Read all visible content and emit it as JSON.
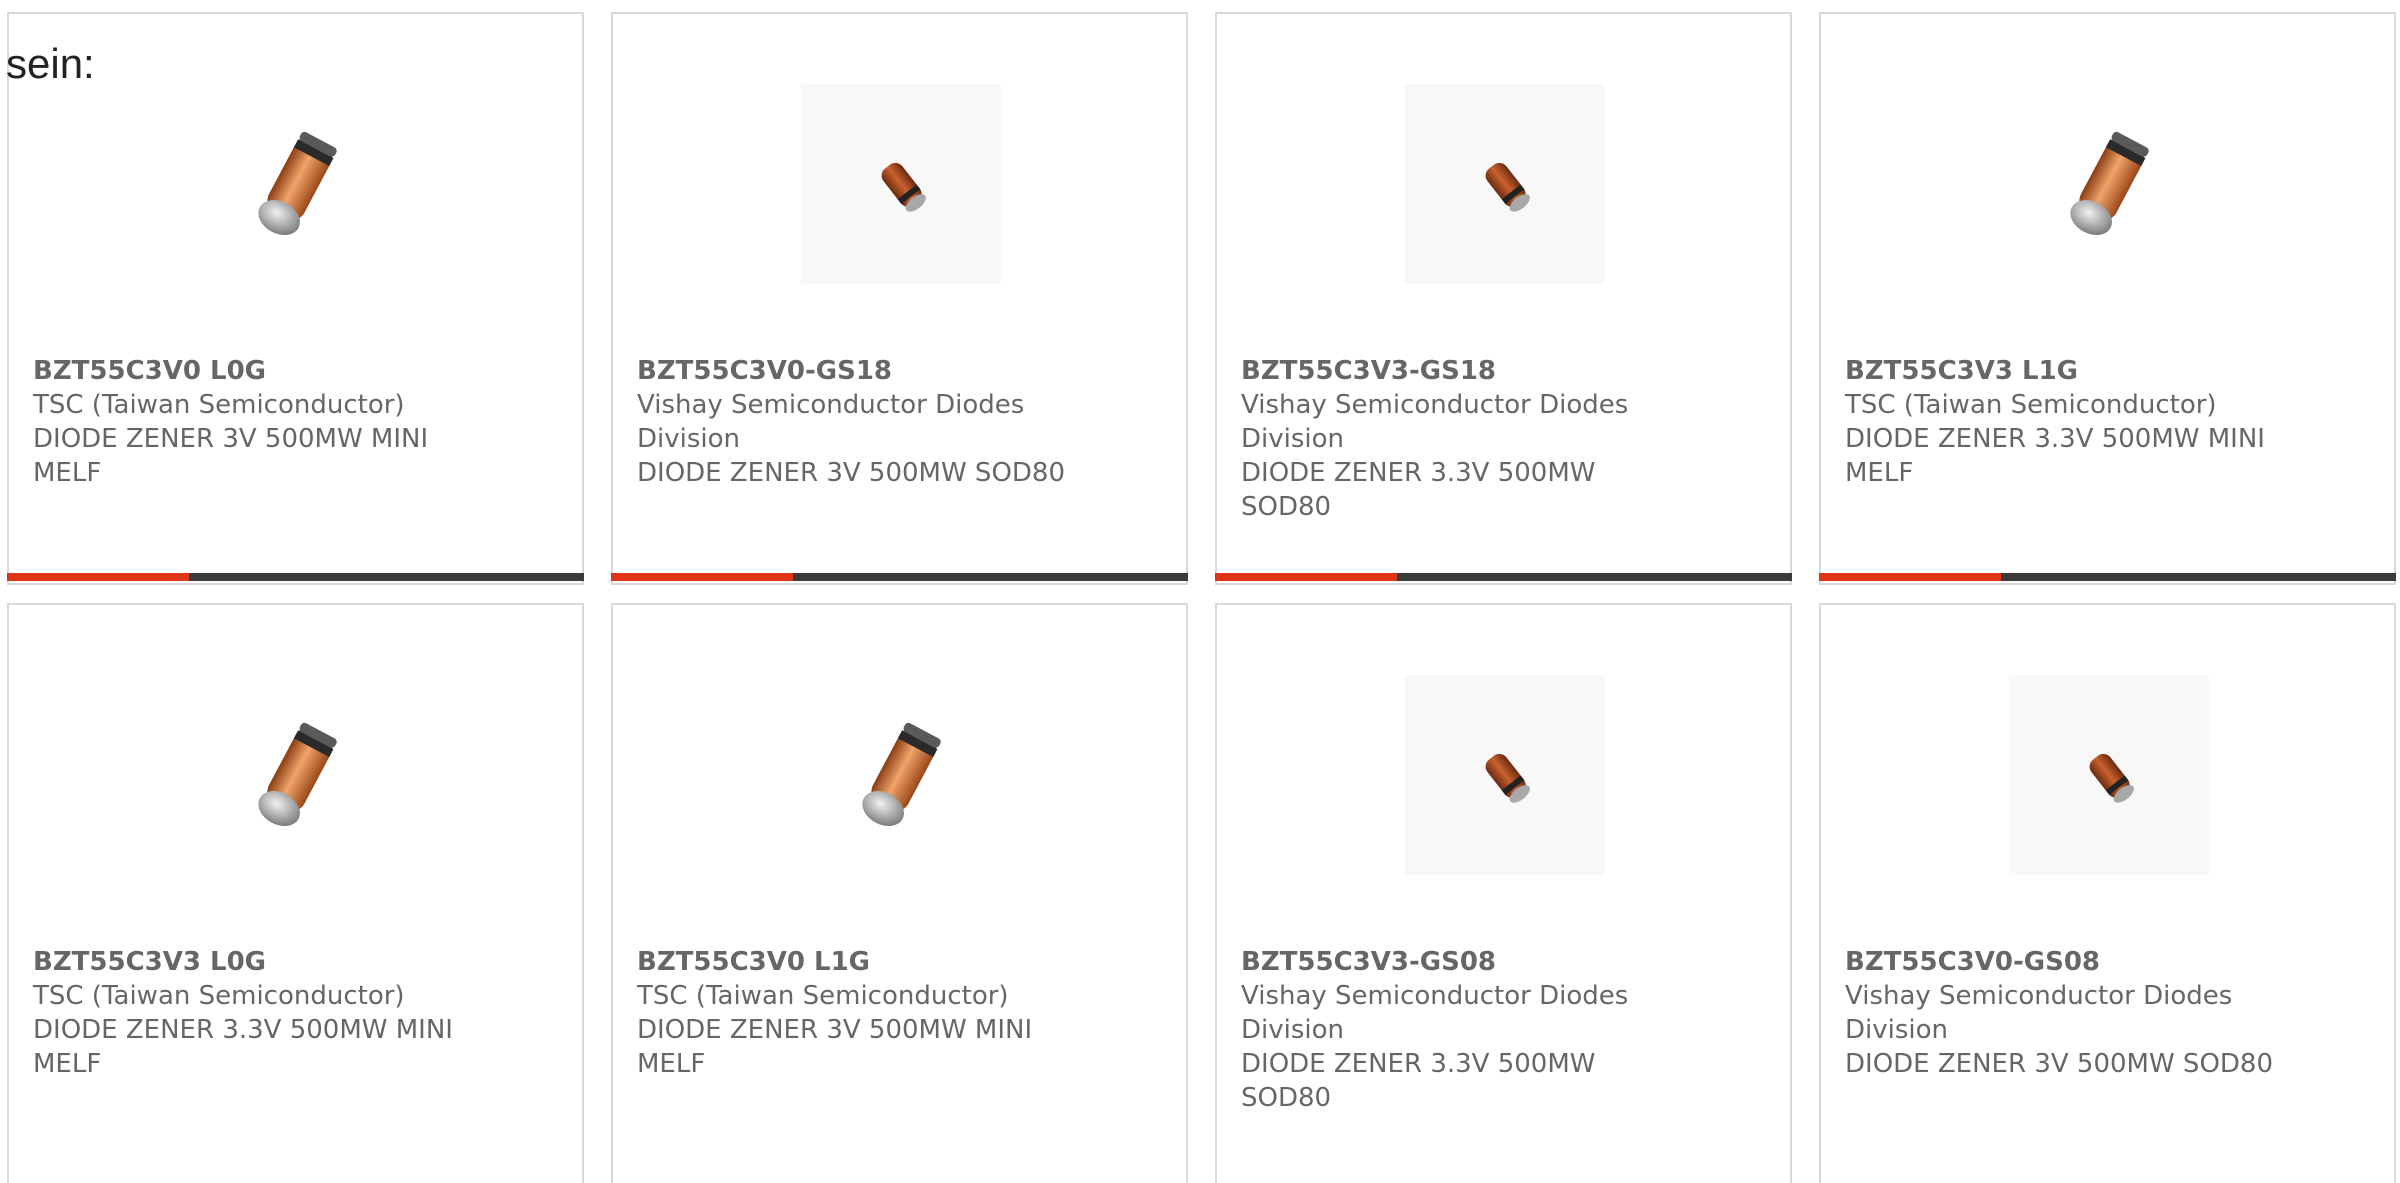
{
  "intro": {
    "text": "sein:"
  },
  "colors": {
    "accent": "#e0341a",
    "bar": "#3a3a3a",
    "border": "#d9d9d9",
    "text": "#666666"
  },
  "cards": [
    {
      "part_number": "BZT55C3V0 L0G",
      "manufacturer": "TSC (Taiwan Semiconductor)",
      "description": "DIODE ZENER 3V 500MW MINI MELF",
      "image_icon": "mini-melf-diode-icon"
    },
    {
      "part_number": "BZT55C3V0-GS18",
      "manufacturer": "Vishay Semiconductor Diodes Division",
      "description": "DIODE ZENER 3V 500MW SOD80",
      "image_icon": "sod80-diode-icon"
    },
    {
      "part_number": "BZT55C3V3-GS18",
      "manufacturer": "Vishay Semiconductor Diodes Division",
      "description": "DIODE ZENER 3.3V 500MW SOD80",
      "image_icon": "sod80-diode-icon"
    },
    {
      "part_number": "BZT55C3V3 L1G",
      "manufacturer": "TSC (Taiwan Semiconductor)",
      "description": "DIODE ZENER 3.3V 500MW MINI MELF",
      "image_icon": "mini-melf-diode-icon"
    },
    {
      "part_number": "BZT55C3V3 L0G",
      "manufacturer": "TSC (Taiwan Semiconductor)",
      "description": "DIODE ZENER 3.3V 500MW MINI MELF",
      "image_icon": "mini-melf-diode-icon"
    },
    {
      "part_number": "BZT55C3V0 L1G",
      "manufacturer": "TSC (Taiwan Semiconductor)",
      "description": "DIODE ZENER 3V 500MW MINI MELF",
      "image_icon": "mini-melf-diode-icon"
    },
    {
      "part_number": "BZT55C3V3-GS08",
      "manufacturer": "Vishay Semiconductor Diodes Division",
      "description": "DIODE ZENER 3.3V 500MW SOD80",
      "image_icon": "sod80-diode-icon"
    },
    {
      "part_number": "BZT55C3V0-GS08",
      "manufacturer": "Vishay Semiconductor Diodes Division",
      "description": "DIODE ZENER 3V 500MW SOD80",
      "image_icon": "sod80-diode-icon"
    }
  ]
}
